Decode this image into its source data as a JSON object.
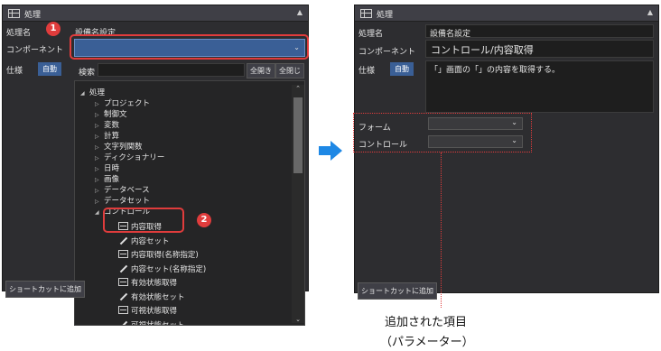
{
  "left_panel": {
    "title": "処理",
    "labels": {
      "name": "処理名",
      "component": "コンポーネント",
      "spec": "仕様"
    },
    "name_value": "設備名設定",
    "spec_badge": "自動",
    "search_label": "検索",
    "search_value": "",
    "expand_all": "全開き",
    "collapse_all": "全閉じ",
    "shortcut_button": "ショートカットに追加",
    "tree": {
      "root": "処理",
      "folders": [
        "プロジェクト",
        "制御文",
        "変数",
        "計算",
        "文字列関数",
        "ディクショナリー",
        "日時",
        "画像",
        "データベース",
        "データセット"
      ],
      "expanded_folder": "コントロール",
      "items": [
        {
          "label": "内容取得",
          "icon": "grid-icon"
        },
        {
          "label": "内容セット",
          "icon": "pen-icon"
        },
        {
          "label": "内容取得(名称指定)",
          "icon": "grid-icon"
        },
        {
          "label": "内容セット(名称指定)",
          "icon": "pen-icon"
        },
        {
          "label": "有効状態取得",
          "icon": "grid-icon"
        },
        {
          "label": "有効状態セット",
          "icon": "pen-icon"
        },
        {
          "label": "可視状態取得",
          "icon": "grid-icon"
        },
        {
          "label": "可視状態セット",
          "icon": "pen-icon"
        }
      ]
    },
    "markers": {
      "one": "1",
      "two": "2"
    }
  },
  "right_panel": {
    "title": "処理",
    "labels": {
      "name": "処理名",
      "component": "コンポーネント",
      "spec": "仕様",
      "form": "フォーム",
      "control": "コントロール"
    },
    "name_value": "設備名設定",
    "component_value": "コントロール/内容取得",
    "spec_badge": "自動",
    "spec_description": "「」画面の「」の内容を取得する。",
    "form_value": "",
    "control_value": "",
    "shortcut_button": "ショートカットに追加"
  },
  "caption": {
    "line1": "追加された項目",
    "line2": "（パラメーター）"
  },
  "colors": {
    "accent_blue": "#3a5f96",
    "annotation_red": "#e03c3c",
    "arrow_blue": "#1e88e5",
    "panel_bg": "#2d2d30"
  }
}
